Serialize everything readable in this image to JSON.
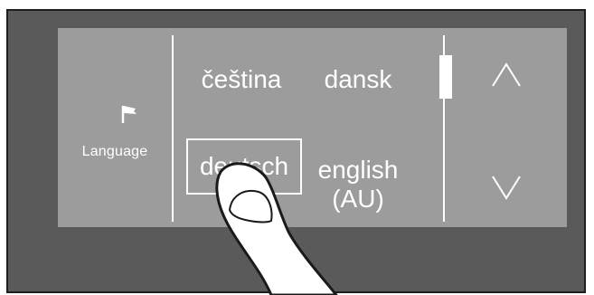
{
  "panel": {
    "label": "Language",
    "icon": "flag-icon"
  },
  "languages": [
    {
      "label": "čeština",
      "selected": false
    },
    {
      "label": "dansk",
      "selected": false
    },
    {
      "label": "deutsch",
      "selected": true
    },
    {
      "label": "english\n(AU)",
      "selected": false
    }
  ],
  "navigation": {
    "up_icon": "chevron-up-icon",
    "down_icon": "chevron-down-icon"
  },
  "scroll_position": 0.2
}
